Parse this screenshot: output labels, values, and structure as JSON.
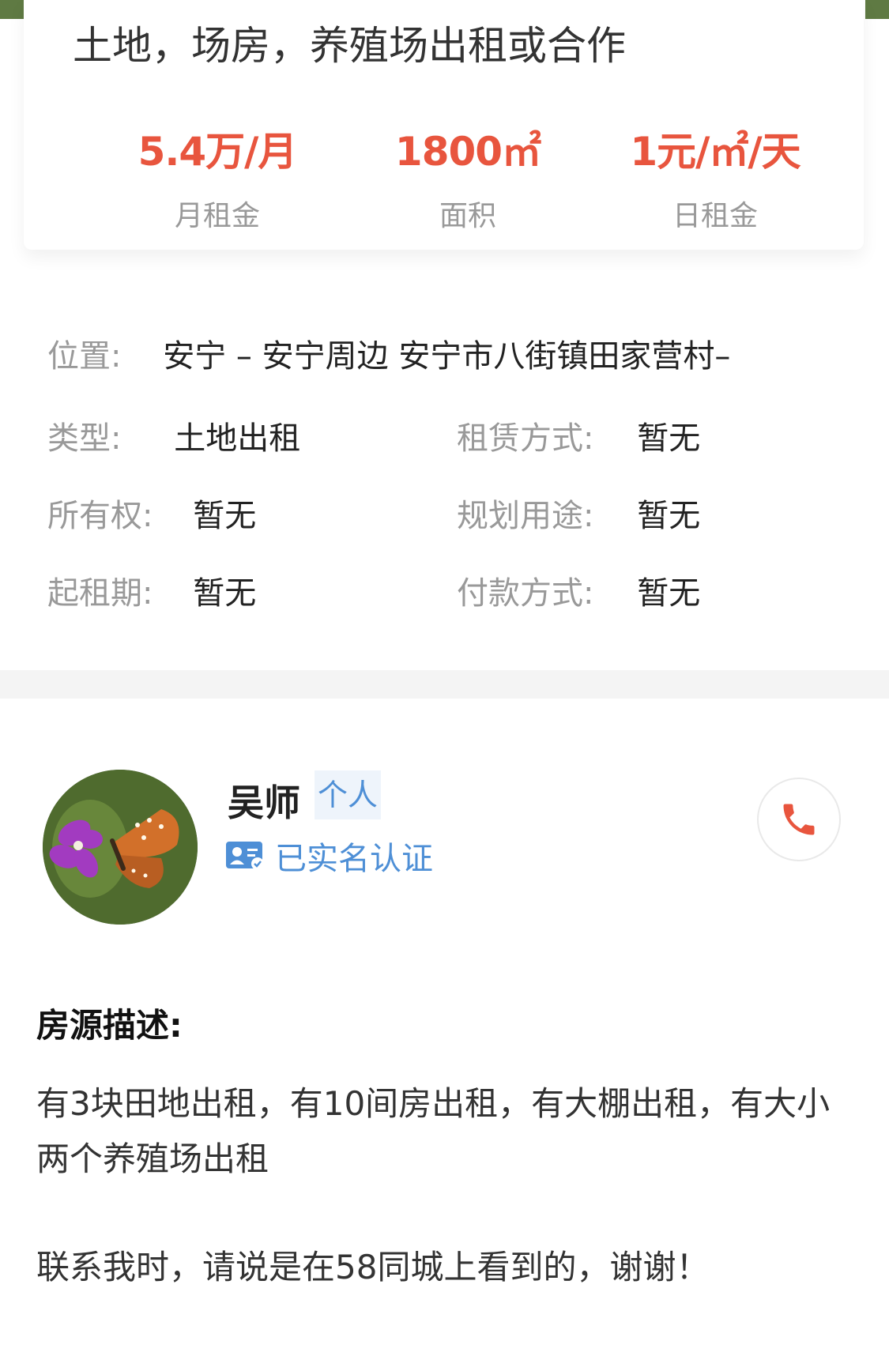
{
  "listing": {
    "title": "土地，场房，养殖场出租或合作"
  },
  "stats": [
    {
      "value": "5.4万/月",
      "label": "月租金"
    },
    {
      "value": "1800㎡",
      "label": "面积"
    },
    {
      "value": "1元/㎡/天",
      "label": "日租金"
    }
  ],
  "details": {
    "location_label": "位置:",
    "location_value": "安宁 – 安宁周边 安宁市八街镇田家营村–",
    "type_label": "类型:",
    "type_value": "土地出租",
    "lease_label": "租赁方式:",
    "lease_value": "暂无",
    "ownership_label": "所有权:",
    "ownership_value": "暂无",
    "plan_label": "规划用途:",
    "plan_value": "暂无",
    "start_label": "起租期:",
    "start_value": "暂无",
    "payment_label": "付款方式:",
    "payment_value": "暂无"
  },
  "owner": {
    "name": "吴师",
    "type": "个人",
    "verified_text": "已实名认证",
    "avatar_icon": "butterfly-avatar",
    "phone_icon": "phone-icon"
  },
  "description": {
    "title": "房源描述:",
    "body": "有3块田地出租，有10间房出租，有大棚出租，有大小两个养殖场出租",
    "note": "联系我时，请说是在58同城上看到的，谢谢！"
  },
  "colors": {
    "accent": "#e8553e",
    "link": "#4e8fd6",
    "muted": "#999999"
  }
}
